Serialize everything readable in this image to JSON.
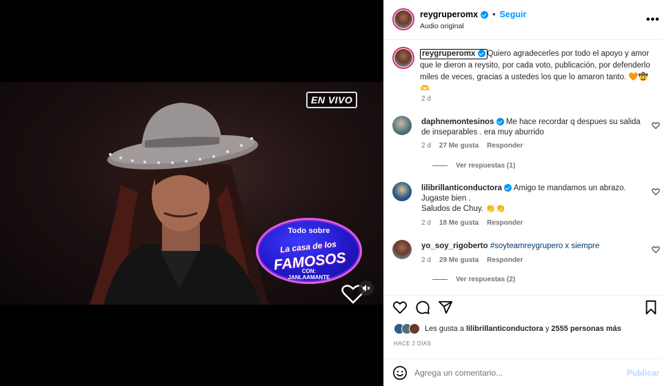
{
  "media": {
    "badge_live": "EN VIVO",
    "promo_top": "Todo sobre",
    "promo_main_1": "La casa de los",
    "promo_main_2": "FAMOSOS",
    "promo_sub_1": "CON:",
    "promo_sub_2": "JANLAAMANTE",
    "mute_icon": "speaker-muted-icon"
  },
  "header": {
    "username": "reygruperomx",
    "separator": "•",
    "follow_label": "Seguir",
    "audio_label": "Audio original",
    "more_label": "•••"
  },
  "caption": {
    "username": "reygruperomx",
    "text": "Quiero agradecerles por todo el apoyo y amor que le dieron a reysito, por cada voto, publicación, por defenderlo miles de veces, gracias a ustedes los que lo amaron tanto. 🧡🤠🫶",
    "age": "2 d"
  },
  "comments": [
    {
      "username": "daphnemontesinos",
      "text": "Me hace recordar q despues su salida de inseparables . era muy aburrido",
      "age": "2 d",
      "likes": "27 Me gusta",
      "reply_label": "Responder",
      "view_replies": "Ver respuestas (1)"
    },
    {
      "username": "lilibrillanticonductora",
      "text_lines": [
        "Amigo te mandamos un abrazo.",
        "Jugaste bien .",
        "Saludos de Chuy. 👏👏"
      ],
      "age": "2 d",
      "likes": "18 Me gusta",
      "reply_label": "Responder"
    },
    {
      "username": "yo_soy_rigoberto",
      "text": "#soyteamreygrupero x siempre",
      "age": "2 d",
      "likes": "29 Me gusta",
      "reply_label": "Responder",
      "view_replies": "Ver respuestas (2)"
    }
  ],
  "likes": {
    "prefix": "Les gusta a ",
    "user": "lilibrillanticonductora",
    "middle": " y ",
    "count": "2555 personas más"
  },
  "posted_ago": "HACE 2 DÍAS",
  "comment_box": {
    "placeholder": "Agrega un comentario...",
    "publish_label": "Publicar"
  },
  "colors": {
    "accent": "#0095f6",
    "publish_disabled": "#b3dbff",
    "meta_text": "#737373"
  }
}
